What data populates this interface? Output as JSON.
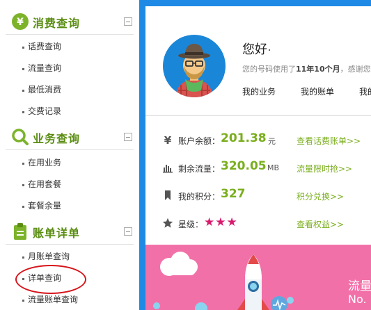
{
  "sidebar": {
    "sections": [
      {
        "title": "消费查询",
        "icon": "yuan-icon",
        "items": [
          "话费查询",
          "流量查询",
          "最低消费",
          "交费记录"
        ]
      },
      {
        "title": "业务查询",
        "icon": "magnifier-icon",
        "items": [
          "在用业务",
          "在用套餐",
          "套餐余量"
        ]
      },
      {
        "title": "账单详单",
        "icon": "clipboard-icon",
        "items": [
          "月账单查询",
          "详单查询",
          "流量账单查询"
        ]
      }
    ],
    "highlighted_item": "详单查询"
  },
  "profile": {
    "greeting": "您好",
    "usage_prefix": "您的号码使用了",
    "usage_duration": "11年10个月",
    "usage_suffix": "，感谢您",
    "links": [
      "我的业务",
      "我的账单",
      "我的"
    ]
  },
  "account": {
    "balance_label": "账户余额：",
    "balance_value": "201.38",
    "balance_unit": "元",
    "balance_link": "查看话费账单>>",
    "data_label": "剩余流量：",
    "data_value": "320.05",
    "data_unit": "MB",
    "data_link": "流量限时抢>>",
    "points_label": "我的积分：",
    "points_value": "327",
    "points_link": "积分兑换>>",
    "level_label": "星级：",
    "level_stars": "★★★",
    "level_stars_count": 3,
    "level_link": "查看权益>>"
  },
  "banner": {
    "title": "流量",
    "subtitle": "No."
  },
  "colors": {
    "accent_blue": "#1e8ae6",
    "accent_green": "#7aae1d",
    "section_green": "#5a8d12",
    "star_pink": "#d81b6e",
    "banner_pink": "#f270a8",
    "highlight_red": "#d7141b"
  }
}
